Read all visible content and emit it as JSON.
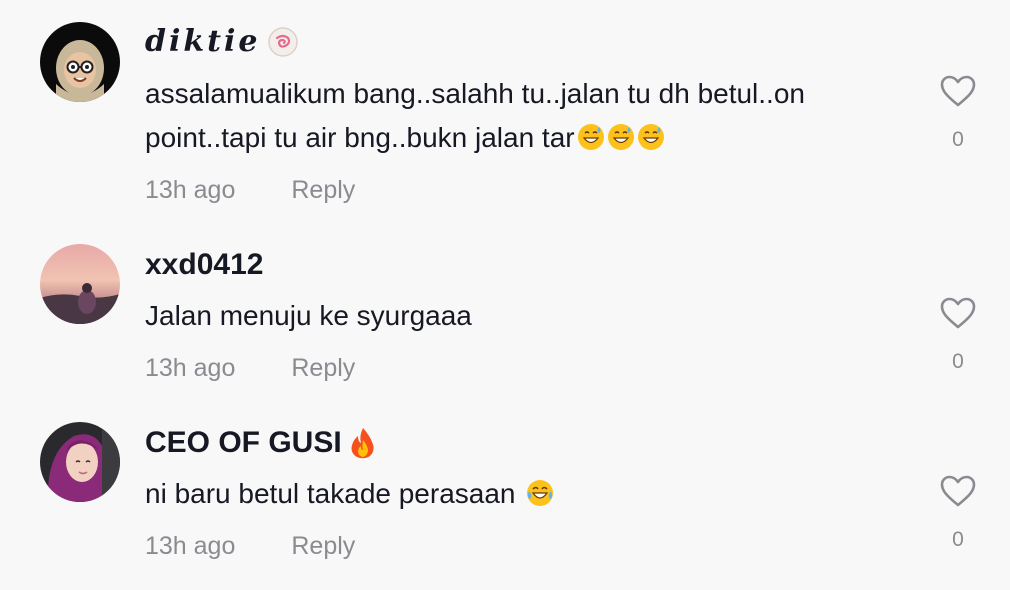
{
  "comments": [
    {
      "username": "diktie",
      "username_badge": "fishcake-emoji",
      "text": "assalamualikum bang..salahh tu..jalan tu dh betul..on point..tapi tu air bng..bukn jalan tar",
      "text_emoji": [
        "grinning-sweat-emoji",
        "grinning-sweat-emoji",
        "grinning-sweat-emoji"
      ],
      "time": "13h ago",
      "reply_label": "Reply",
      "like_count": "0",
      "like_icon": "heart-outline-icon"
    },
    {
      "username": "xxd0412",
      "text": "Jalan menuju ke syurgaaa",
      "time": "13h ago",
      "reply_label": "Reply",
      "like_count": "0",
      "like_icon": "heart-outline-icon"
    },
    {
      "username": "CEO OF GUSI",
      "username_badge": "fire-emoji",
      "text": "ni baru betul takade perasaan",
      "text_emoji": [
        "tears-of-joy-emoji"
      ],
      "time": "13h ago",
      "reply_label": "Reply",
      "like_count": "0",
      "like_icon": "heart-outline-icon"
    }
  ],
  "colors": {
    "background": "#f8f8f8",
    "primary_text": "#161823",
    "secondary_text": "#8a8b91"
  }
}
